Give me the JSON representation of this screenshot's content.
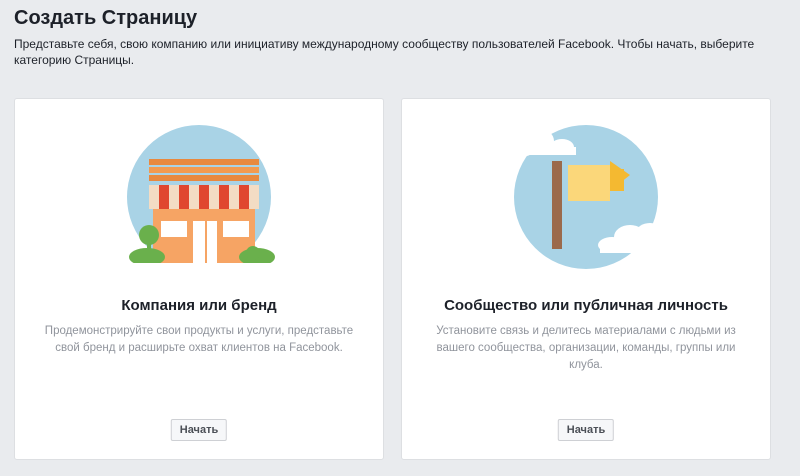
{
  "header": {
    "title": "Создать Страницу",
    "description": "Представьте себя, свою компанию или инициативу международному сообществу пользователей Facebook. Чтобы начать, выберите категорию Страницы."
  },
  "cards": [
    {
      "title": "Компания или бренд",
      "description": "Продемонстрируйте свои продукты и услуги, представьте свой бренд и расширьте охват клиентов на Facebook.",
      "button_label": "Начать",
      "icon": "storefront-icon"
    },
    {
      "title": "Сообщество или публичная личность",
      "description": "Установите связь и делитесь материалами с людьми из вашего сообщества, организации, команды, группы или клуба.",
      "button_label": "Начать",
      "icon": "flag-icon"
    }
  ],
  "colors": {
    "background": "#e9ebee",
    "card": "#ffffff",
    "illustration_circle": "#a9d3e6",
    "awning_red": "#e0472f",
    "building_orange": "#f6a464",
    "bush_green": "#6ab04c",
    "flag_yellow": "#f7c948",
    "pole_brown": "#9b6a4c"
  }
}
